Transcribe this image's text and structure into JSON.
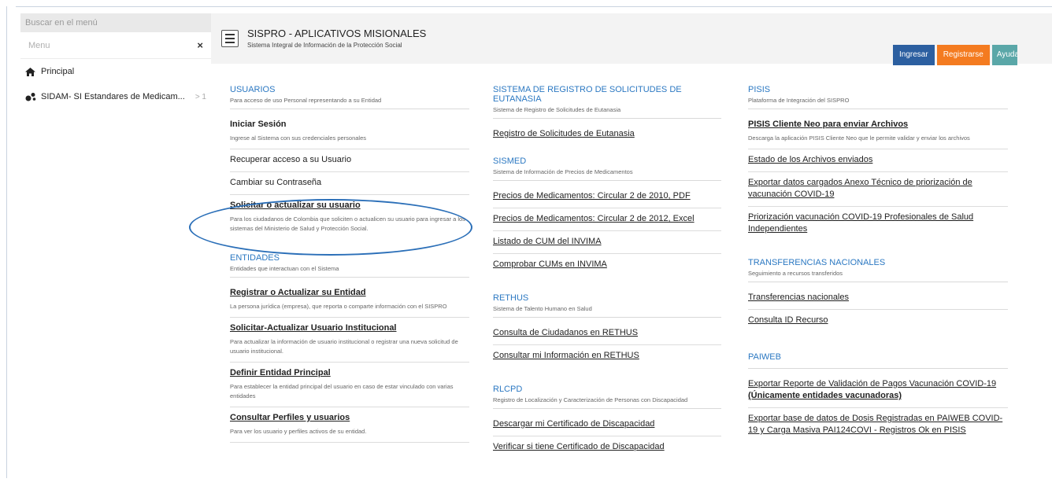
{
  "sidebar": {
    "search_placeholder": "Buscar en el menú",
    "menu_label": "Menu",
    "close_glyph": "×",
    "items": [
      {
        "label": "Principal",
        "icon": "home-icon"
      },
      {
        "label": "SIDAM- SI Estandares de Medicam...",
        "icon": "circles-icon",
        "count": "> 1"
      }
    ]
  },
  "header": {
    "title": "SISPRO - APLICATIVOS MISIONALES",
    "subtitle": "Sistema Integral de Información de la Protección Social",
    "buttons": {
      "ingresar": "Ingresar",
      "registrarse": "Registrarse",
      "ayuda": "Ayuda"
    }
  },
  "colors": {
    "accent": "#2b78c2",
    "ingresar": "#2c5fa0",
    "registrarse": "#f47b20",
    "ayuda": "#5aa7a8",
    "ellipse": "#2b6fb8"
  },
  "col1": {
    "usuarios": {
      "title": "USUARIOS",
      "subtitle": "Para acceso de uso Personal representando a su Entidad",
      "items": [
        {
          "label": "Iniciar Sesión",
          "desc": "Ingrese al Sistema con sus credenciales personales"
        },
        {
          "label": "Recuperar acceso a su Usuario"
        },
        {
          "label": "Cambiar su Contraseña"
        },
        {
          "label": "Solicitar o actualizar su usuario",
          "desc": "Para los ciudadanos de Colombia que soliciten o actualicen su usuario para ingresar a los sistemas del Ministerio de Salud y Protección Social."
        }
      ]
    },
    "entidades": {
      "title": "ENTIDADES",
      "subtitle": "Entidades que interactuan con el Sistema",
      "items": [
        {
          "label": "Registrar o Actualizar su Entidad",
          "desc": "La persona jurídica (empresa), que reporta o comparte información con el SISPRO"
        },
        {
          "label": "Solicitar-Actualizar Usuario Institucional",
          "desc": "Para actualizar la información de usuario institucional o registrar una nueva solicitud de usuario institucional."
        },
        {
          "label": "Definir Entidad Principal",
          "desc": "Para establecer la entidad principal del usuario en caso de estar vinculado con varias entidades"
        },
        {
          "label": "Consultar Perfiles y usuarios",
          "desc": "Para ver los usuario y perfiles activos de su entidad."
        }
      ]
    }
  },
  "col2": {
    "eutanasia": {
      "title": "SISTEMA DE REGISTRO DE SOLICITUDES DE EUTANASIA",
      "subtitle": "Sistema de Registro de Solicitudes de Eutanasia",
      "items": [
        {
          "label": "Registro de Solicitudes de Eutanasia"
        }
      ]
    },
    "sismed": {
      "title": "SISMED",
      "subtitle": "Sistema de Información de Precios de Medicamentos",
      "items": [
        {
          "label": "Precios de Medicamentos: Circular 2 de 2010, PDF"
        },
        {
          "label": "Precios de Medicamentos: Circular 2 de 2012, Excel"
        },
        {
          "label": "Listado de CUM del INVIMA"
        },
        {
          "label": "Comprobar CUMs en INVIMA"
        }
      ]
    },
    "rethus": {
      "title": "RETHUS",
      "subtitle": "Sistema de Talento Humano en Salud",
      "items": [
        {
          "label": "Consulta de Ciudadanos en RETHUS"
        },
        {
          "label": "Consultar mi Información en RETHUS"
        }
      ]
    },
    "rlcpd": {
      "title": "RLCPD",
      "subtitle": "Registro de Localización y Caracterización de Personas con Discapacidad",
      "items": [
        {
          "label": "Descargar mi Certificado de Discapacidad"
        },
        {
          "label": "Verificar si tiene Certificado de Discapacidad"
        }
      ]
    }
  },
  "col3": {
    "pisis": {
      "title": "PISIS",
      "subtitle": "Plataforma de Integración del SISPRO",
      "items": [
        {
          "label": "PISIS Cliente Neo para enviar Archivos",
          "desc": "Descarga la aplicación PISIS Cliente Neo que le permite validar y enviar los archivos"
        },
        {
          "label": "Estado de los Archivos enviados"
        },
        {
          "label": "Exportar datos cargados Anexo Técnico de priorización de vacunación COVID-19"
        },
        {
          "label": "Priorización vacunación COVID-19 Profesionales de Salud Independientes"
        }
      ]
    },
    "transferencias": {
      "title": "TRANSFERENCIAS NACIONALES",
      "subtitle": "Seguimiento a recursos transferidos",
      "items": [
        {
          "label": "Transferencias nacionales"
        },
        {
          "label": "Consulta ID Recurso"
        }
      ]
    },
    "paiweb": {
      "title": "PAIWEB",
      "items": [
        {
          "label": "Exportar Reporte de Validación de Pagos Vacunación COVID-19",
          "label_bold": "(Únicamente entidades vacunadoras)"
        },
        {
          "label": "Exportar base de datos de Dosis Registradas en PAIWEB COVID-19 y Carga Masiva PAI124COVI - Registros Ok en PISIS"
        }
      ]
    }
  }
}
